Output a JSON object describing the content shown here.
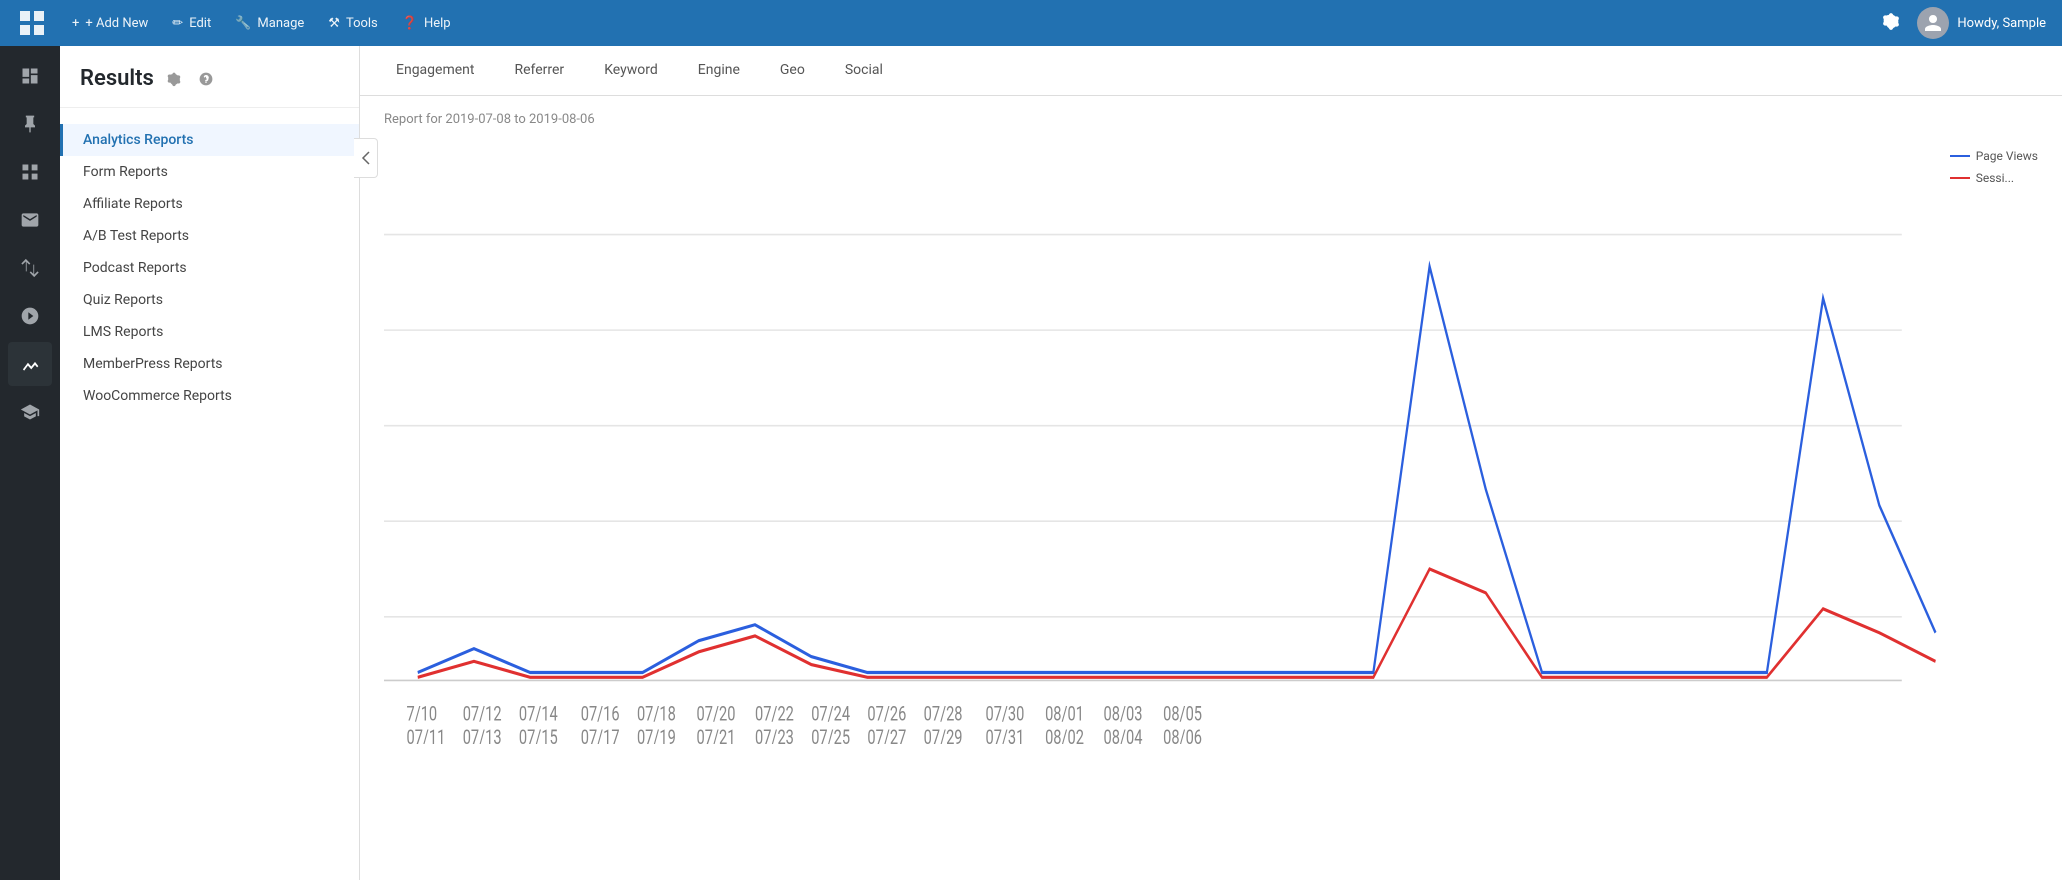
{
  "topnav": {
    "add_new": "+ Add New",
    "edit": "Edit",
    "manage": "Manage",
    "tools": "Tools",
    "help": "Help",
    "user_greeting": "Howdy, Sample"
  },
  "sidebar_icons": [
    {
      "name": "dashboard-icon",
      "label": "Dashboard"
    },
    {
      "name": "pin-icon",
      "label": "Pin"
    },
    {
      "name": "grid-icon",
      "label": "Grid"
    },
    {
      "name": "mail-icon",
      "label": "Mail"
    },
    {
      "name": "arrows-icon",
      "label": "Arrows"
    },
    {
      "name": "target-icon",
      "label": "Target"
    },
    {
      "name": "chart-icon",
      "label": "Chart",
      "active": true
    },
    {
      "name": "graduation-icon",
      "label": "Graduation"
    }
  ],
  "left_panel": {
    "title": "Results",
    "nav_items": [
      {
        "label": "Analytics Reports",
        "active": true
      },
      {
        "label": "Form Reports"
      },
      {
        "label": "Affiliate Reports"
      },
      {
        "label": "A/B Test Reports"
      },
      {
        "label": "Podcast Reports"
      },
      {
        "label": "Quiz Reports"
      },
      {
        "label": "LMS Reports"
      },
      {
        "label": "MemberPress Reports"
      },
      {
        "label": "WooCommerce Reports"
      }
    ]
  },
  "main": {
    "tabs": [
      {
        "label": "Engagement"
      },
      {
        "label": "Referrer"
      },
      {
        "label": "Keyword"
      },
      {
        "label": "Engine"
      },
      {
        "label": "Geo"
      },
      {
        "label": "Social"
      }
    ],
    "chart_subtitle": "Report for 2019-07-08 to 2019-08-06",
    "legend": {
      "page_views": "Page Views",
      "sessions": "Sessi..."
    },
    "x_labels": [
      "7/10",
      "07/11",
      "07/12",
      "07/13",
      "07/14",
      "07/15",
      "07/16",
      "07/17",
      "07/18",
      "07/19",
      "07/20",
      "07/21",
      "07/22",
      "07/23",
      "07/24",
      "07/25",
      "07/26",
      "07/27",
      "07/28",
      "07/29",
      "07/30",
      "07/31",
      "08/01",
      "08/02",
      "08/03",
      "08/04",
      "08/05",
      "08/06"
    ]
  }
}
